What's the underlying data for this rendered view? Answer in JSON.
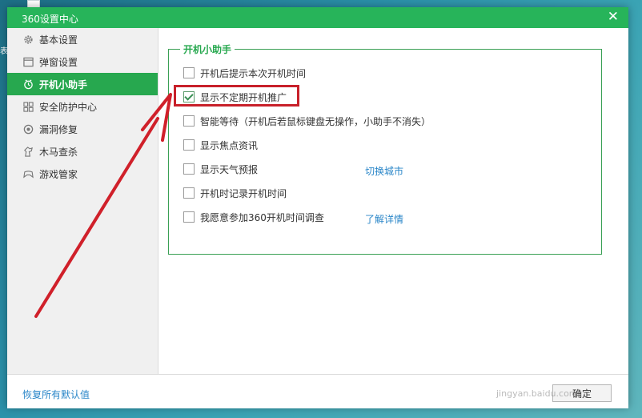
{
  "window": {
    "title": "360设置中心",
    "close_glyph": "✕",
    "accent_color": "#27b45a"
  },
  "sidebar": {
    "items": [
      {
        "label": "基本设置",
        "icon": "gear-icon",
        "active": false
      },
      {
        "label": "弹窗设置",
        "icon": "window-icon",
        "active": false
      },
      {
        "label": "开机小助手",
        "icon": "clock-icon",
        "active": true
      },
      {
        "label": "安全防护中心",
        "icon": "grid-icon",
        "active": false
      },
      {
        "label": "漏洞修复",
        "icon": "patch-icon",
        "active": false
      },
      {
        "label": "木马查杀",
        "icon": "horse-icon",
        "active": false
      },
      {
        "label": "游戏管家",
        "icon": "gamepad-icon",
        "active": false
      }
    ]
  },
  "section": {
    "legend": "开机小助手",
    "options": [
      {
        "label": "开机后提示本次开机时间",
        "checked": false
      },
      {
        "label": "显示不定期开机推广",
        "checked": true
      },
      {
        "label": "智能等待（开机后若鼠标键盘无操作，小助手不消失）",
        "checked": false
      },
      {
        "label": "显示焦点资讯",
        "checked": false
      },
      {
        "label": "显示天气预报",
        "checked": false,
        "link": "切换城市"
      },
      {
        "label": "开机时记录开机时间",
        "checked": false
      },
      {
        "label": "我愿意参加360开机时间调查",
        "checked": false,
        "link": "了解详情"
      }
    ]
  },
  "footer": {
    "restore_label": "恢复所有默认值",
    "ok_label": "确定"
  },
  "annotation": {
    "highlight_color": "#c8202a"
  },
  "watermark": {
    "text": "Baidu经验",
    "url_text": "jingyan.baidu.com"
  }
}
